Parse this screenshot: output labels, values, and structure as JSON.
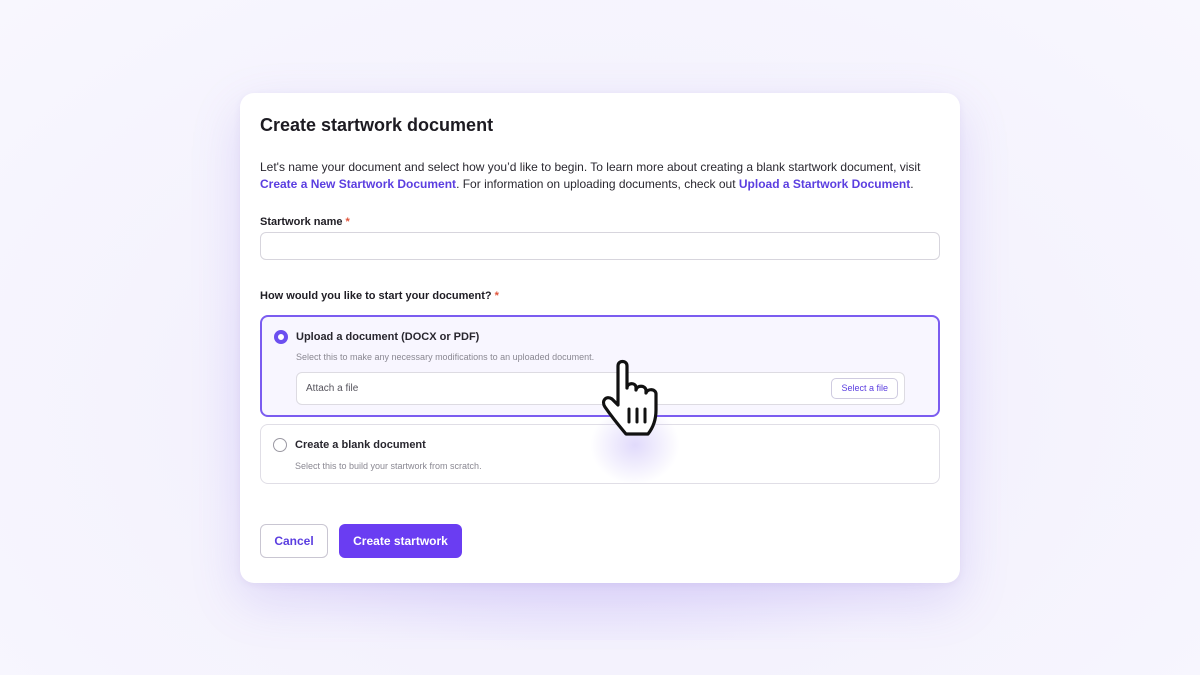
{
  "modal": {
    "title": "Create startwork document",
    "intro": {
      "text1": "Let's name your document and select how you’d like to begin. To learn more about creating a blank startwork document, visit ",
      "link1": "Create a New Startwork Document",
      "text2": ". For information on uploading documents, check out ",
      "link2": "Upload a Startwork Document",
      "text3": "."
    },
    "name_field": {
      "label": "Startwork name",
      "required_mark": "*",
      "value": "",
      "placeholder": ""
    },
    "start_question": {
      "label": "How would you like to start your document?",
      "required_mark": "*"
    },
    "options": [
      {
        "title": "Upload a document (DOCX or PDF)",
        "description": "Select this to make any necessary modifications to an uploaded document.",
        "selected": true,
        "attach_text": "Attach a file",
        "select_file_label": "Select a file"
      },
      {
        "title": "Create a blank document",
        "description": "Select this to build your startwork from scratch.",
        "selected": false
      }
    ],
    "buttons": {
      "cancel": "Cancel",
      "create": "Create startwork"
    }
  },
  "colors": {
    "accent": "#6a3df2",
    "link": "#5b3ee0",
    "required": "#e0553c",
    "selected_border": "#7b5cf0"
  },
  "icons": {
    "cursor": "hand-pointer-icon"
  }
}
